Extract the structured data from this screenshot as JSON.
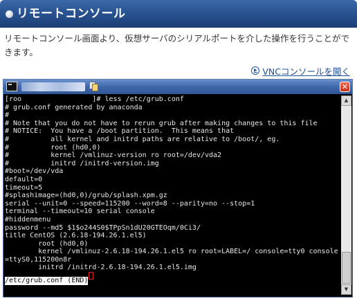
{
  "header": {
    "title": "リモートコンソール",
    "gradient_color": "#264f8c"
  },
  "description": "リモートコンソール画面より、仮想サーバのシリアルポートを介した操作を行うことができます。",
  "vnc_link": {
    "label": "VNCコンソールを開く",
    "icon": "circle-arrow-right-icon",
    "color": "#1d4f96"
  },
  "window": {
    "icon": "terminal-icon",
    "title_masked": true,
    "copy_icon": "copy-icon",
    "close_label": "✕",
    "close_color": "#d93c23"
  },
  "console": {
    "lines": [
      "[roo                 ]# less /etc/grub.conf",
      "# grub.conf generated by anaconda",
      "#",
      "# Note that you do not have to rerun grub after making changes to this file",
      "# NOTICE:  You have a /boot partition.  This means that",
      "#          all kernel and initrd paths are relative to /boot/, eg.",
      "#          root (hd0,0)",
      "#          kernel /vmlinuz-version ro root=/dev/vda2",
      "#          initrd /initrd-version.img",
      "#boot=/dev/vda",
      "default=0",
      "timeout=5",
      "#splashimage=(hd0,0)/grub/splash.xpm.gz",
      "serial --unit=0 --speed=115200 --word=8 --parity=no --stop=1",
      "terminal --timeout=10 serial console",
      "#hiddenmenu",
      "password --md5 $1$o244S0$TPpSn1dU20GTEOqm/0Ci3/",
      "title CentOS (2.6.18-194.26.1.el5)",
      "        root (hd0,0)",
      "        kernel /vmlinuz-2.6.18-194.26.1.el5 ro root=LABEL=/ console=tty0 console",
      "=ttyS0,115200n8r",
      "        initrd /initrd-2.6.18-194.26.1.el5.img"
    ],
    "status_line": "/etc/grub.conf (END)",
    "background": "#000000",
    "foreground": "#e8e8e8"
  },
  "scrollbar": {
    "up_icon": "scroll-up-arrow-icon",
    "down_icon": "scroll-down-arrow-icon"
  }
}
